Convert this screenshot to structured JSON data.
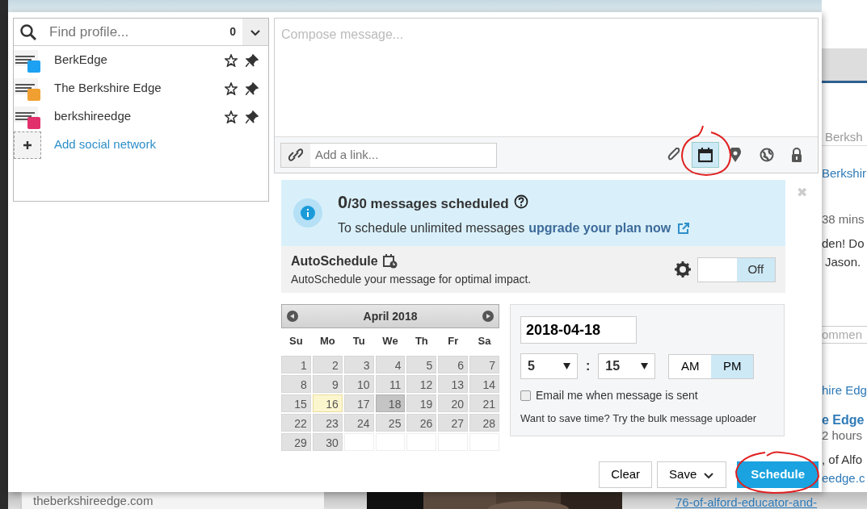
{
  "profile_panel": {
    "search": {
      "placeholder": "Find profile...",
      "count": "0"
    },
    "profiles": [
      {
        "name": "BerkEdge",
        "color": "#1da1f2"
      },
      {
        "name": "The Berkshire Edge",
        "color": "#f0a030"
      },
      {
        "name": "berkshireedge",
        "color": "#e1306c"
      }
    ],
    "add_network": "Add social network"
  },
  "composer": {
    "placeholder": "Compose message...",
    "link_placeholder": "Add a link...",
    "tools": [
      {
        "kind": "attach",
        "selected": false
      },
      {
        "kind": "schedule",
        "selected": true
      },
      {
        "kind": "location",
        "selected": false
      },
      {
        "kind": "privacy",
        "selected": false
      },
      {
        "kind": "lock",
        "selected": false
      }
    ]
  },
  "scheduler": {
    "close": "✖",
    "quota": {
      "count": "0",
      "label": "/30 messages scheduled",
      "text": "To schedule unlimited messages",
      "link": "upgrade your plan now"
    },
    "autoschedule": {
      "title": "AutoSchedule",
      "description": "AutoSchedule your message for optimal impact.",
      "on": false,
      "toggle_label": "Off"
    },
    "calendar": {
      "month": "April 2018",
      "weekdays": [
        "Su",
        "Mo",
        "Tu",
        "We",
        "Th",
        "Fr",
        "Sa"
      ],
      "days": [
        {
          "label": "1",
          "selected": false,
          "today": false
        },
        {
          "label": "2",
          "selected": false,
          "today": false
        },
        {
          "label": "3",
          "selected": false,
          "today": false
        },
        {
          "label": "4",
          "selected": false,
          "today": false
        },
        {
          "label": "5",
          "selected": false,
          "today": false
        },
        {
          "label": "6",
          "selected": false,
          "today": false
        },
        {
          "label": "7",
          "selected": false,
          "today": false
        },
        {
          "label": "8",
          "selected": false,
          "today": false
        },
        {
          "label": "9",
          "selected": false,
          "today": false
        },
        {
          "label": "10",
          "selected": false,
          "today": false
        },
        {
          "label": "11",
          "selected": false,
          "today": false
        },
        {
          "label": "12",
          "selected": false,
          "today": false
        },
        {
          "label": "13",
          "selected": false,
          "today": false
        },
        {
          "label": "14",
          "selected": false,
          "today": false
        },
        {
          "label": "15",
          "selected": false,
          "today": false
        },
        {
          "label": "16",
          "selected": false,
          "today": true
        },
        {
          "label": "17",
          "selected": false,
          "today": false
        },
        {
          "label": "18",
          "selected": true,
          "today": false
        },
        {
          "label": "19",
          "selected": false,
          "today": false
        },
        {
          "label": "20",
          "selected": false,
          "today": false
        },
        {
          "label": "21",
          "selected": false,
          "today": false
        },
        {
          "label": "22",
          "selected": false,
          "today": false
        },
        {
          "label": "23",
          "selected": false,
          "today": false
        },
        {
          "label": "24",
          "selected": false,
          "today": false
        },
        {
          "label": "25",
          "selected": false,
          "today": false
        },
        {
          "label": "26",
          "selected": false,
          "today": false
        },
        {
          "label": "27",
          "selected": false,
          "today": false
        },
        {
          "label": "28",
          "selected": false,
          "today": false
        },
        {
          "label": "29",
          "selected": false,
          "today": false
        },
        {
          "label": "30",
          "selected": false,
          "today": false
        }
      ]
    },
    "date": "2018-04-18",
    "hour": "5",
    "separator": ":",
    "minute": "15",
    "periods": [
      {
        "label": "AM",
        "selected": false
      },
      {
        "label": "PM",
        "selected": true
      }
    ],
    "email_option": {
      "label": "Email me when message is sent",
      "checked": false
    },
    "hint": {
      "text": "Want to save time? Try the",
      "link": "bulk message uploader"
    }
  },
  "actions": [
    {
      "label": "Clear",
      "kind": "plain"
    },
    {
      "label": "Save",
      "kind": "dropdown"
    },
    {
      "label": "Schedule",
      "kind": "primary"
    }
  ],
  "background": {
    "right_column": [
      {
        "text": "Berksh",
        "kind": "tab"
      },
      {
        "text": "Berkshir",
        "kind": "link"
      },
      {
        "text": "38 mins",
        "kind": "meta"
      },
      {
        "text": "den! Do",
        "kind": "body"
      },
      {
        "text": "Jason.",
        "kind": "body"
      },
      {
        "text": "ommen",
        "kind": "input"
      },
      {
        "text": "hire Edg",
        "kind": "link"
      },
      {
        "text": "e Edge",
        "kind": "title"
      },
      {
        "text": "2 hours",
        "kind": "meta"
      },
      {
        "text": ", of Alfo",
        "kind": "body"
      },
      {
        "text": "eedge.c",
        "kind": "link"
      }
    ],
    "site": "theberkshireedge.com",
    "link": "76-of-alford-educator-and-"
  }
}
